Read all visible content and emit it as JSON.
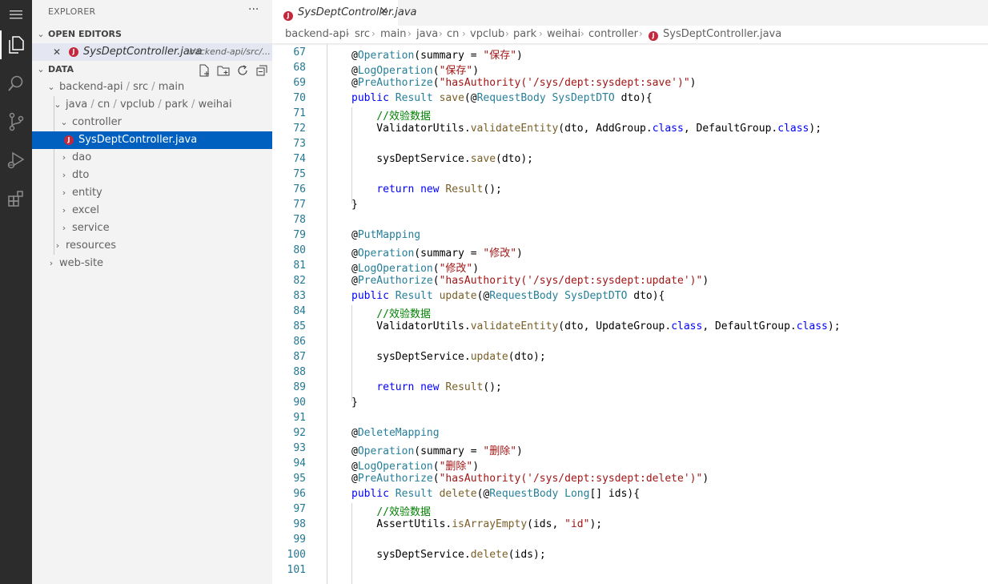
{
  "activity_bar": {
    "items": [
      {
        "name": "menu-icon"
      },
      {
        "name": "explorer-icon"
      },
      {
        "name": "search-icon"
      },
      {
        "name": "source-control-icon"
      },
      {
        "name": "run-debug-icon"
      },
      {
        "name": "extensions-icon"
      }
    ]
  },
  "sidebar": {
    "title": "EXPLORER",
    "more": "···",
    "open_editors_label": "OPEN EDITORS",
    "open_editor_file": "SysDeptController.java",
    "open_editor_path": "backend-api/src/...",
    "workspace_label": "DATA",
    "tree": {
      "backend": "backend-api",
      "src": "src",
      "main": "main",
      "java": "java",
      "cn": "cn",
      "vpclub": "vpclub",
      "park": "park",
      "weihai": "weihai",
      "controller": "controller",
      "file": "SysDeptController.java",
      "dao": "dao",
      "dto": "dto",
      "entity": "entity",
      "excel": "excel",
      "service": "service",
      "resources": "resources",
      "website": "web-site"
    }
  },
  "tab": {
    "label": "SysDeptController.java",
    "close": "✕"
  },
  "breadcrumb": [
    "backend-api",
    "src",
    "main",
    "java",
    "cn",
    "vpclub",
    "park",
    "weihai",
    "controller",
    "SysDeptController.java"
  ],
  "line_numbers": [
    "67",
    "68",
    "69",
    "70",
    "71",
    "72",
    "73",
    "74",
    "75",
    "76",
    "77",
    "78",
    "79",
    "80",
    "81",
    "82",
    "83",
    "84",
    "85",
    "86",
    "87",
    "88",
    "89",
    "90",
    "91",
    "92",
    "93",
    "94",
    "95",
    "96",
    "97",
    "98",
    "99",
    "100",
    "101"
  ]
}
